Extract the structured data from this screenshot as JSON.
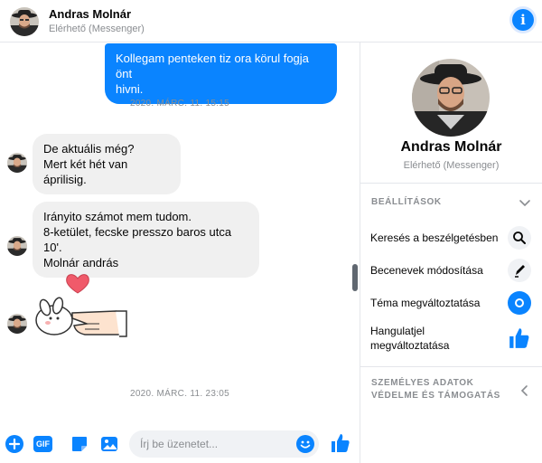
{
  "header": {
    "name": "Andras Molnár",
    "status": "Elérhető (Messenger)",
    "info_glyph": "i"
  },
  "messages": [
    {
      "type": "out",
      "lines": [
        "Kollegam penteken tiz ora körul fogja önt",
        "hivni."
      ]
    },
    {
      "type": "timestamp",
      "text": "2020. MÁRC. 11. 15:15"
    },
    {
      "type": "in",
      "lines": [
        "De aktuális még?",
        "Mert két hét van áprilisig."
      ]
    },
    {
      "type": "in",
      "lines": [
        "Irányito számot mem tudom.",
        "8-ketület, fecske presszo baros utca 10'.",
        "Molnár andrás"
      ]
    },
    {
      "type": "sticker",
      "icon": "heart-finger-sticker"
    },
    {
      "type": "timestamp",
      "text": "2020. MÁRC. 11. 23:05"
    }
  ],
  "composer": {
    "placeholder": "Írj be üzenetet...",
    "gif_label": "GIF",
    "icons": [
      "plus-icon",
      "gif-icon",
      "sticker-icon",
      "image-icon",
      "emoji-icon",
      "like-icon"
    ]
  },
  "panel": {
    "name": "Andras Molnár",
    "status": "Elérhető (Messenger)",
    "settings_header": "BEÁLLÍTÁSOK",
    "items": [
      {
        "label": "Keresés a beszélgetésben",
        "icon": "search-icon"
      },
      {
        "label": "Becenevek módosítása",
        "icon": "pencil-icon"
      },
      {
        "label": "Téma megváltoztatása",
        "icon": "theme-icon"
      },
      {
        "label_line1": "Hangulatjel",
        "label_line2": "megváltoztatása",
        "icon": "thumbs-up-icon"
      }
    ],
    "privacy_header_line1": "SZEMÉLYES ADATOK",
    "privacy_header_line2": "VÉDELME ÉS TÁMOGATÁS"
  },
  "colors": {
    "accent": "#0a84ff",
    "bubble_in": "#f0f0f0",
    "muted_text": "#8a8d91"
  }
}
